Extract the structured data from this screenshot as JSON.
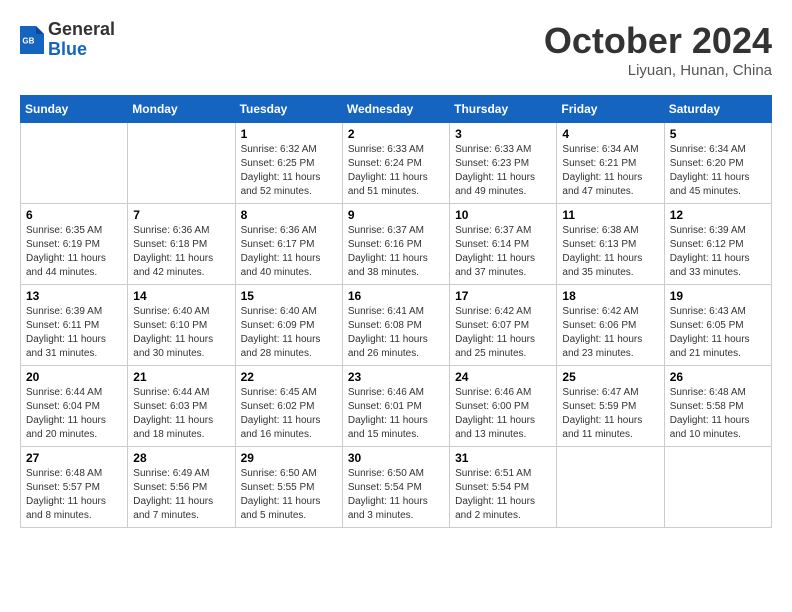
{
  "header": {
    "logo": {
      "general": "General",
      "blue": "Blue"
    },
    "title": "October 2024",
    "location": "Liyuan, Hunan, China"
  },
  "calendar": {
    "days_of_week": [
      "Sunday",
      "Monday",
      "Tuesday",
      "Wednesday",
      "Thursday",
      "Friday",
      "Saturday"
    ],
    "weeks": [
      [
        {
          "day": "",
          "info": ""
        },
        {
          "day": "",
          "info": ""
        },
        {
          "day": "1",
          "info": "Sunrise: 6:32 AM\nSunset: 6:25 PM\nDaylight: 11 hours and 52 minutes."
        },
        {
          "day": "2",
          "info": "Sunrise: 6:33 AM\nSunset: 6:24 PM\nDaylight: 11 hours and 51 minutes."
        },
        {
          "day": "3",
          "info": "Sunrise: 6:33 AM\nSunset: 6:23 PM\nDaylight: 11 hours and 49 minutes."
        },
        {
          "day": "4",
          "info": "Sunrise: 6:34 AM\nSunset: 6:21 PM\nDaylight: 11 hours and 47 minutes."
        },
        {
          "day": "5",
          "info": "Sunrise: 6:34 AM\nSunset: 6:20 PM\nDaylight: 11 hours and 45 minutes."
        }
      ],
      [
        {
          "day": "6",
          "info": "Sunrise: 6:35 AM\nSunset: 6:19 PM\nDaylight: 11 hours and 44 minutes."
        },
        {
          "day": "7",
          "info": "Sunrise: 6:36 AM\nSunset: 6:18 PM\nDaylight: 11 hours and 42 minutes."
        },
        {
          "day": "8",
          "info": "Sunrise: 6:36 AM\nSunset: 6:17 PM\nDaylight: 11 hours and 40 minutes."
        },
        {
          "day": "9",
          "info": "Sunrise: 6:37 AM\nSunset: 6:16 PM\nDaylight: 11 hours and 38 minutes."
        },
        {
          "day": "10",
          "info": "Sunrise: 6:37 AM\nSunset: 6:14 PM\nDaylight: 11 hours and 37 minutes."
        },
        {
          "day": "11",
          "info": "Sunrise: 6:38 AM\nSunset: 6:13 PM\nDaylight: 11 hours and 35 minutes."
        },
        {
          "day": "12",
          "info": "Sunrise: 6:39 AM\nSunset: 6:12 PM\nDaylight: 11 hours and 33 minutes."
        }
      ],
      [
        {
          "day": "13",
          "info": "Sunrise: 6:39 AM\nSunset: 6:11 PM\nDaylight: 11 hours and 31 minutes."
        },
        {
          "day": "14",
          "info": "Sunrise: 6:40 AM\nSunset: 6:10 PM\nDaylight: 11 hours and 30 minutes."
        },
        {
          "day": "15",
          "info": "Sunrise: 6:40 AM\nSunset: 6:09 PM\nDaylight: 11 hours and 28 minutes."
        },
        {
          "day": "16",
          "info": "Sunrise: 6:41 AM\nSunset: 6:08 PM\nDaylight: 11 hours and 26 minutes."
        },
        {
          "day": "17",
          "info": "Sunrise: 6:42 AM\nSunset: 6:07 PM\nDaylight: 11 hours and 25 minutes."
        },
        {
          "day": "18",
          "info": "Sunrise: 6:42 AM\nSunset: 6:06 PM\nDaylight: 11 hours and 23 minutes."
        },
        {
          "day": "19",
          "info": "Sunrise: 6:43 AM\nSunset: 6:05 PM\nDaylight: 11 hours and 21 minutes."
        }
      ],
      [
        {
          "day": "20",
          "info": "Sunrise: 6:44 AM\nSunset: 6:04 PM\nDaylight: 11 hours and 20 minutes."
        },
        {
          "day": "21",
          "info": "Sunrise: 6:44 AM\nSunset: 6:03 PM\nDaylight: 11 hours and 18 minutes."
        },
        {
          "day": "22",
          "info": "Sunrise: 6:45 AM\nSunset: 6:02 PM\nDaylight: 11 hours and 16 minutes."
        },
        {
          "day": "23",
          "info": "Sunrise: 6:46 AM\nSunset: 6:01 PM\nDaylight: 11 hours and 15 minutes."
        },
        {
          "day": "24",
          "info": "Sunrise: 6:46 AM\nSunset: 6:00 PM\nDaylight: 11 hours and 13 minutes."
        },
        {
          "day": "25",
          "info": "Sunrise: 6:47 AM\nSunset: 5:59 PM\nDaylight: 11 hours and 11 minutes."
        },
        {
          "day": "26",
          "info": "Sunrise: 6:48 AM\nSunset: 5:58 PM\nDaylight: 11 hours and 10 minutes."
        }
      ],
      [
        {
          "day": "27",
          "info": "Sunrise: 6:48 AM\nSunset: 5:57 PM\nDaylight: 11 hours and 8 minutes."
        },
        {
          "day": "28",
          "info": "Sunrise: 6:49 AM\nSunset: 5:56 PM\nDaylight: 11 hours and 7 minutes."
        },
        {
          "day": "29",
          "info": "Sunrise: 6:50 AM\nSunset: 5:55 PM\nDaylight: 11 hours and 5 minutes."
        },
        {
          "day": "30",
          "info": "Sunrise: 6:50 AM\nSunset: 5:54 PM\nDaylight: 11 hours and 3 minutes."
        },
        {
          "day": "31",
          "info": "Sunrise: 6:51 AM\nSunset: 5:54 PM\nDaylight: 11 hours and 2 minutes."
        },
        {
          "day": "",
          "info": ""
        },
        {
          "day": "",
          "info": ""
        }
      ]
    ]
  }
}
